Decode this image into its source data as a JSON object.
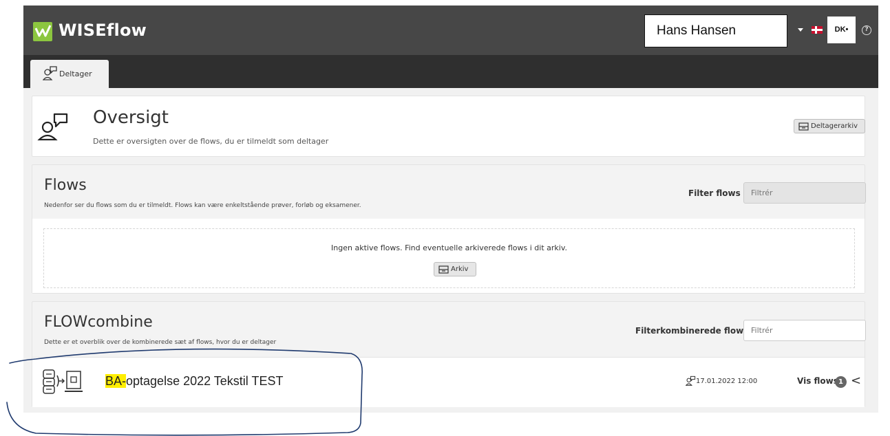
{
  "app": {
    "logo_text": "WISEflow"
  },
  "header": {
    "user_name": "Hans Hansen",
    "institution_badge": "DK•"
  },
  "tabs": [
    {
      "label": "Deltager"
    }
  ],
  "overview": {
    "title": "Oversigt",
    "subtitle": "Dette er oversigten over de flows, du er tilmeldt som deltager",
    "archive_button": "Deltagerarkiv"
  },
  "flows": {
    "title": "Flows",
    "subtitle": "Nedenfor ser du flows som du er tilmeldt. Flows kan være enkeltstående prøver, forløb og eksamener.",
    "filter_label": "Filter flows",
    "filter_placeholder": "Filtrér",
    "empty_message": "Ingen aktive flows. Find eventuelle arkiverede flows i dit arkiv.",
    "archive_button": "Arkiv"
  },
  "flowcombine": {
    "title": "FLOWcombine",
    "subtitle": "Dette er et overblik over de kombinerede sæt af flows, hvor du er deltager",
    "filter_label": "Filterkombinerede flows",
    "filter_placeholder": "Filtrér",
    "item": {
      "name_highlight": "BA-",
      "name_rest": "optagelse 2022 Tekstil TEST",
      "date": "17.01.2022 12:00",
      "show_flows_label": "Vis flows",
      "flow_count": "1",
      "chevron": "<"
    }
  },
  "colors": {
    "header_bg": "#474747",
    "tabbar_bg": "#2f2f2f",
    "logo_green": "#8cc63f",
    "highlight": "#ffee00",
    "annotation": "#1f3a6e"
  }
}
